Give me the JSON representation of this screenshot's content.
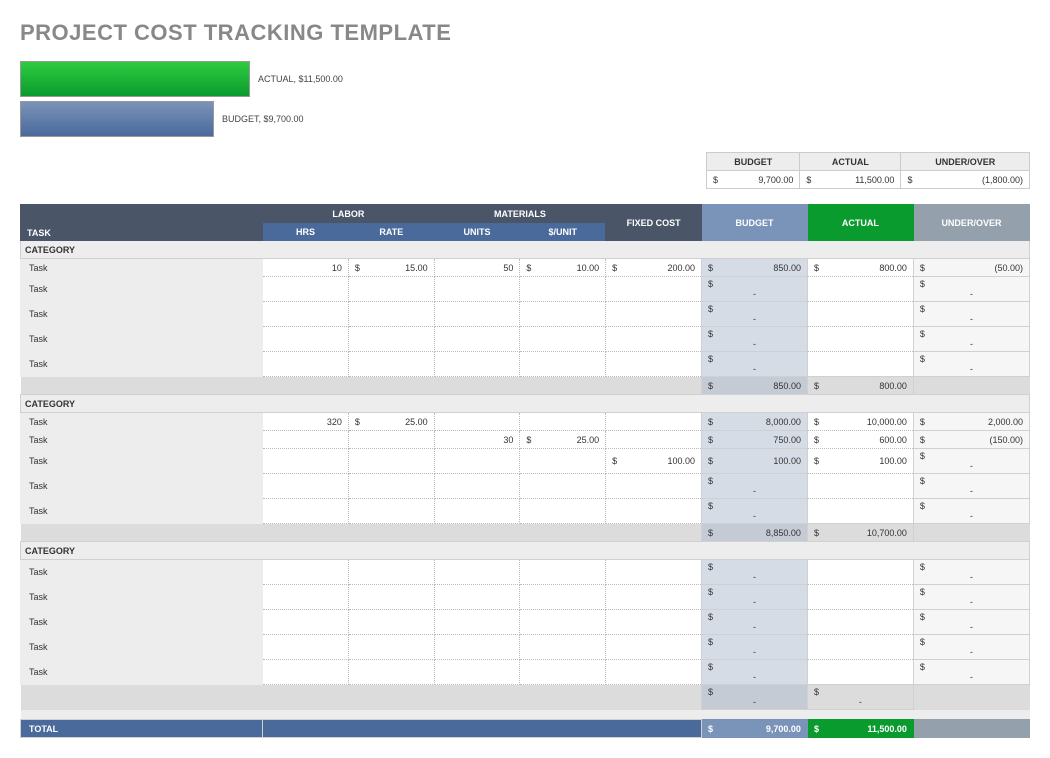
{
  "title": "PROJECT COST TRACKING TEMPLATE",
  "chart": {
    "actual_label": "ACTUAL,  $11,500.00",
    "budget_label": "BUDGET,  $9,700.00"
  },
  "summary": {
    "headers": {
      "budget": "BUDGET",
      "actual": "ACTUAL",
      "uo": "UNDER/OVER"
    },
    "budget": "9,700.00",
    "actual": "11,500.00",
    "uo": "(1,800.00)"
  },
  "headers": {
    "task": "TASK",
    "labor": "LABOR",
    "materials": "MATERIALS",
    "hrs": "HRS",
    "rate": "RATE",
    "units": "UNITS",
    "perunit": "$/UNIT",
    "fixed": "FIXED COST",
    "budget": "BUDGET",
    "actual": "ACTUAL",
    "uo": "UNDER/OVER"
  },
  "cat_label": "CATEGORY",
  "task_label": "Task",
  "categories": [
    {
      "rows": [
        {
          "hrs": "10",
          "rate": "15.00",
          "units": "50",
          "perunit": "10.00",
          "fixed": "200.00",
          "budget": "850.00",
          "actual": "800.00",
          "uo": "(50.00)"
        },
        {
          "budget": "-",
          "uo": "-"
        },
        {
          "budget": "-",
          "uo": "-"
        },
        {
          "budget": "-",
          "uo": "-"
        },
        {
          "budget": "-",
          "uo": "-"
        }
      ],
      "subtotal": {
        "budget": "850.00",
        "actual": "800.00"
      }
    },
    {
      "rows": [
        {
          "hrs": "320",
          "rate": "25.00",
          "budget": "8,000.00",
          "actual": "10,000.00",
          "uo": "2,000.00"
        },
        {
          "units": "30",
          "perunit": "25.00",
          "budget": "750.00",
          "actual": "600.00",
          "uo": "(150.00)"
        },
        {
          "fixed": "100.00",
          "budget": "100.00",
          "actual": "100.00",
          "uo": "-"
        },
        {
          "budget": "-",
          "uo": "-"
        },
        {
          "budget": "-",
          "uo": "-"
        }
      ],
      "subtotal": {
        "budget": "8,850.00",
        "actual": "10,700.00"
      }
    },
    {
      "rows": [
        {
          "budget": "-",
          "uo": "-"
        },
        {
          "budget": "-",
          "uo": "-"
        },
        {
          "budget": "-",
          "uo": "-"
        },
        {
          "budget": "-",
          "uo": "-"
        },
        {
          "budget": "-",
          "uo": "-"
        }
      ],
      "subtotal": {
        "budget": "-",
        "actual": "-"
      }
    }
  ],
  "total": {
    "label": "TOTAL",
    "budget": "9,700.00",
    "actual": "11,500.00"
  },
  "chart_data": {
    "type": "bar",
    "categories": [
      "ACTUAL",
      "BUDGET"
    ],
    "values": [
      11500,
      9700
    ],
    "title": "",
    "xlabel": "",
    "ylabel": ""
  }
}
